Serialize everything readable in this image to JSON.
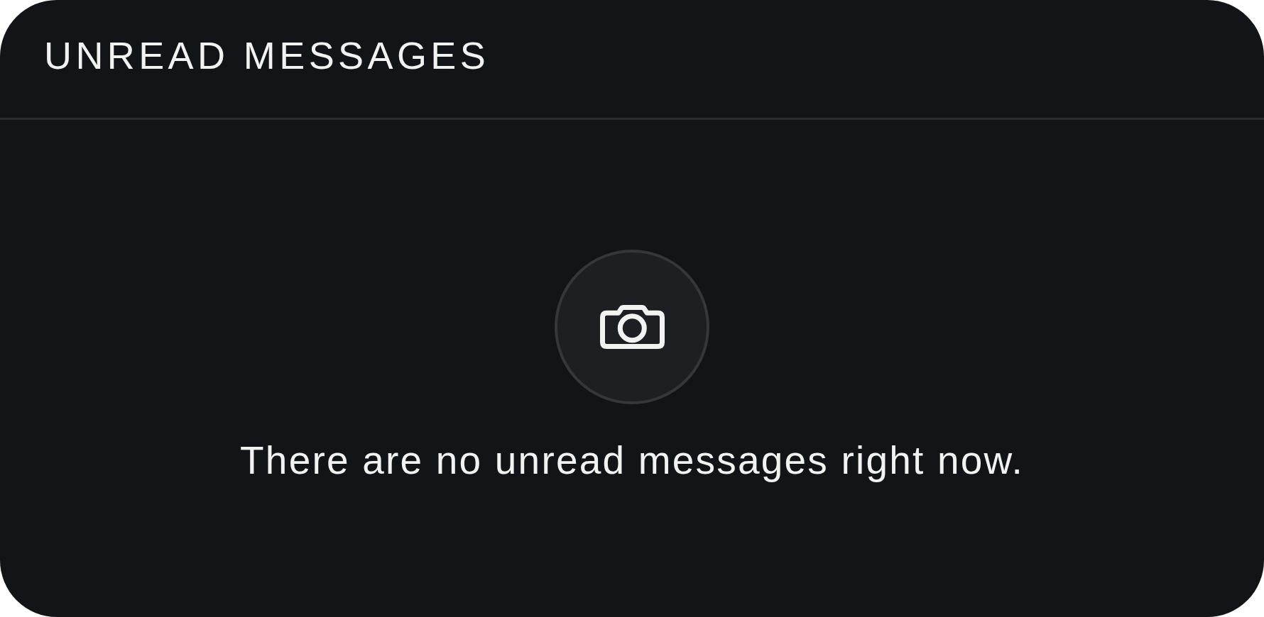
{
  "header": {
    "title": "UNREAD MESSAGES"
  },
  "empty_state": {
    "message": "There are no unread messages right now."
  }
}
